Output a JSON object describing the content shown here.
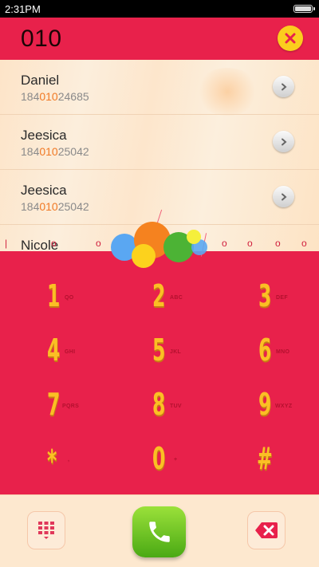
{
  "status_bar": {
    "time": "2:31PM"
  },
  "dialer": {
    "number": "010"
  },
  "contacts": [
    {
      "name": "Daniel",
      "number_prefix": "184",
      "number_match": "010",
      "number_suffix": "24685"
    },
    {
      "name": "Jeesica",
      "number_prefix": "184",
      "number_match": "010",
      "number_suffix": "25042"
    },
    {
      "name": "Jeesica",
      "number_prefix": "184",
      "number_match": "010",
      "number_suffix": "25042"
    },
    {
      "name": "Nicole"
    }
  ],
  "keypad": [
    {
      "digit": "1",
      "letters": "QO"
    },
    {
      "digit": "2",
      "letters": "ABC"
    },
    {
      "digit": "3",
      "letters": "DEF"
    },
    {
      "digit": "4",
      "letters": "GHI"
    },
    {
      "digit": "5",
      "letters": "JKL"
    },
    {
      "digit": "6",
      "letters": "MNO"
    },
    {
      "digit": "7",
      "letters": "PQRS"
    },
    {
      "digit": "8",
      "letters": "TUV"
    },
    {
      "digit": "9",
      "letters": "WXYZ"
    },
    {
      "digit": "*",
      "letters": ","
    },
    {
      "digit": "0",
      "letters": "+"
    },
    {
      "digit": "#",
      "letters": ""
    }
  ],
  "colors": {
    "accent": "#e8214b",
    "digit": "#fbbf24",
    "call": "#5cbf1e",
    "highlight": "#f07a26"
  },
  "icons": {
    "clear": "close-icon",
    "detail": "chevron-right-icon",
    "keypad_toggle": "dialpad-grid-icon",
    "call": "phone-icon",
    "delete": "backspace-icon"
  }
}
